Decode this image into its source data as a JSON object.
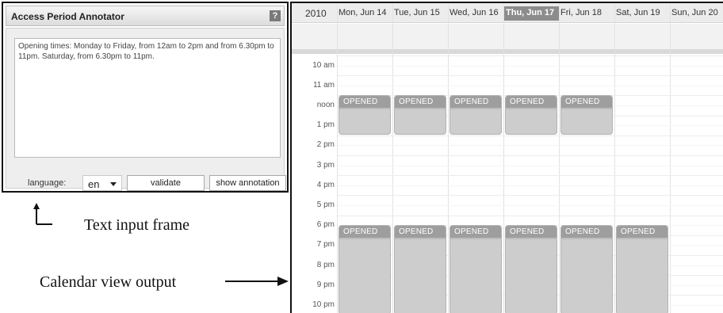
{
  "annotator": {
    "title": "Access Period Annotator",
    "help_glyph": "?",
    "input_text": "Opening times: Monday to Friday, from 12am to 2pm and from 6.30pm to 11pm. Saturday, from 6.30pm to 11pm.",
    "language_label": "language:",
    "language_value": "en",
    "validate_label": "validate",
    "show_annotation_label": "show annotation"
  },
  "captions": {
    "text_input_frame": "Text input frame",
    "calendar_view_output": "Calendar view output"
  },
  "calendar": {
    "year": "2010",
    "days": [
      {
        "label": "Mon, Jun 14",
        "today": false
      },
      {
        "label": "Tue, Jun 15",
        "today": false
      },
      {
        "label": "Wed, Jun 16",
        "today": false
      },
      {
        "label": "Thu, Jun 17",
        "today": true
      },
      {
        "label": "Fri, Jun 18",
        "today": false
      },
      {
        "label": "Sat, Jun 19",
        "today": false
      },
      {
        "label": "Sun, Jun 20",
        "today": false
      }
    ],
    "hours": [
      "10 am",
      "11 am",
      "noon",
      "1 pm",
      "2 pm",
      "3 pm",
      "4 pm",
      "5 pm",
      "6 pm",
      "7 pm",
      "8 pm",
      "9 pm",
      "10 pm"
    ],
    "events": [
      {
        "day": 0,
        "start": 12,
        "end": 14,
        "label": "OPENED"
      },
      {
        "day": 1,
        "start": 12,
        "end": 14,
        "label": "OPENED"
      },
      {
        "day": 2,
        "start": 12,
        "end": 14,
        "label": "OPENED"
      },
      {
        "day": 3,
        "start": 12,
        "end": 14,
        "label": "OPENED"
      },
      {
        "day": 4,
        "start": 12,
        "end": 14,
        "label": "OPENED"
      },
      {
        "day": 0,
        "start": 18.5,
        "end": 23,
        "label": "OPENED"
      },
      {
        "day": 1,
        "start": 18.5,
        "end": 23,
        "label": "OPENED"
      },
      {
        "day": 2,
        "start": 18.5,
        "end": 23,
        "label": "OPENED"
      },
      {
        "day": 3,
        "start": 18.5,
        "end": 23,
        "label": "OPENED"
      },
      {
        "day": 4,
        "start": 18.5,
        "end": 23,
        "label": "OPENED"
      },
      {
        "day": 5,
        "start": 18.5,
        "end": 23,
        "label": "OPENED"
      }
    ]
  }
}
